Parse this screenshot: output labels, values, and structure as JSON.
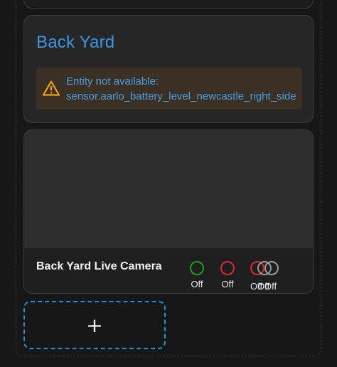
{
  "entities_card": {
    "title": "Back Yard",
    "warning": {
      "icon": "warning-triangle-icon",
      "line1": "Entity not available:",
      "line2": "sensor.aarlo_battery_level_newcastle_right_side"
    }
  },
  "camera_card": {
    "name": "Back Yard Live Camera",
    "statuses": [
      {
        "label": "Off",
        "color": "#1f9d1f"
      },
      {
        "label": "Off",
        "color": "#d42b2b"
      },
      {
        "label": "Off",
        "color": "#d42b2b"
      },
      {
        "label": "Off",
        "color": "#9a9a9a"
      },
      {
        "label": "Off",
        "color": "#9a9a9a"
      }
    ]
  },
  "add_card": {
    "label": "+"
  },
  "colors": {
    "accent": "#3b97e6",
    "warning": "#f2a012",
    "add_border": "#1a93d4"
  }
}
